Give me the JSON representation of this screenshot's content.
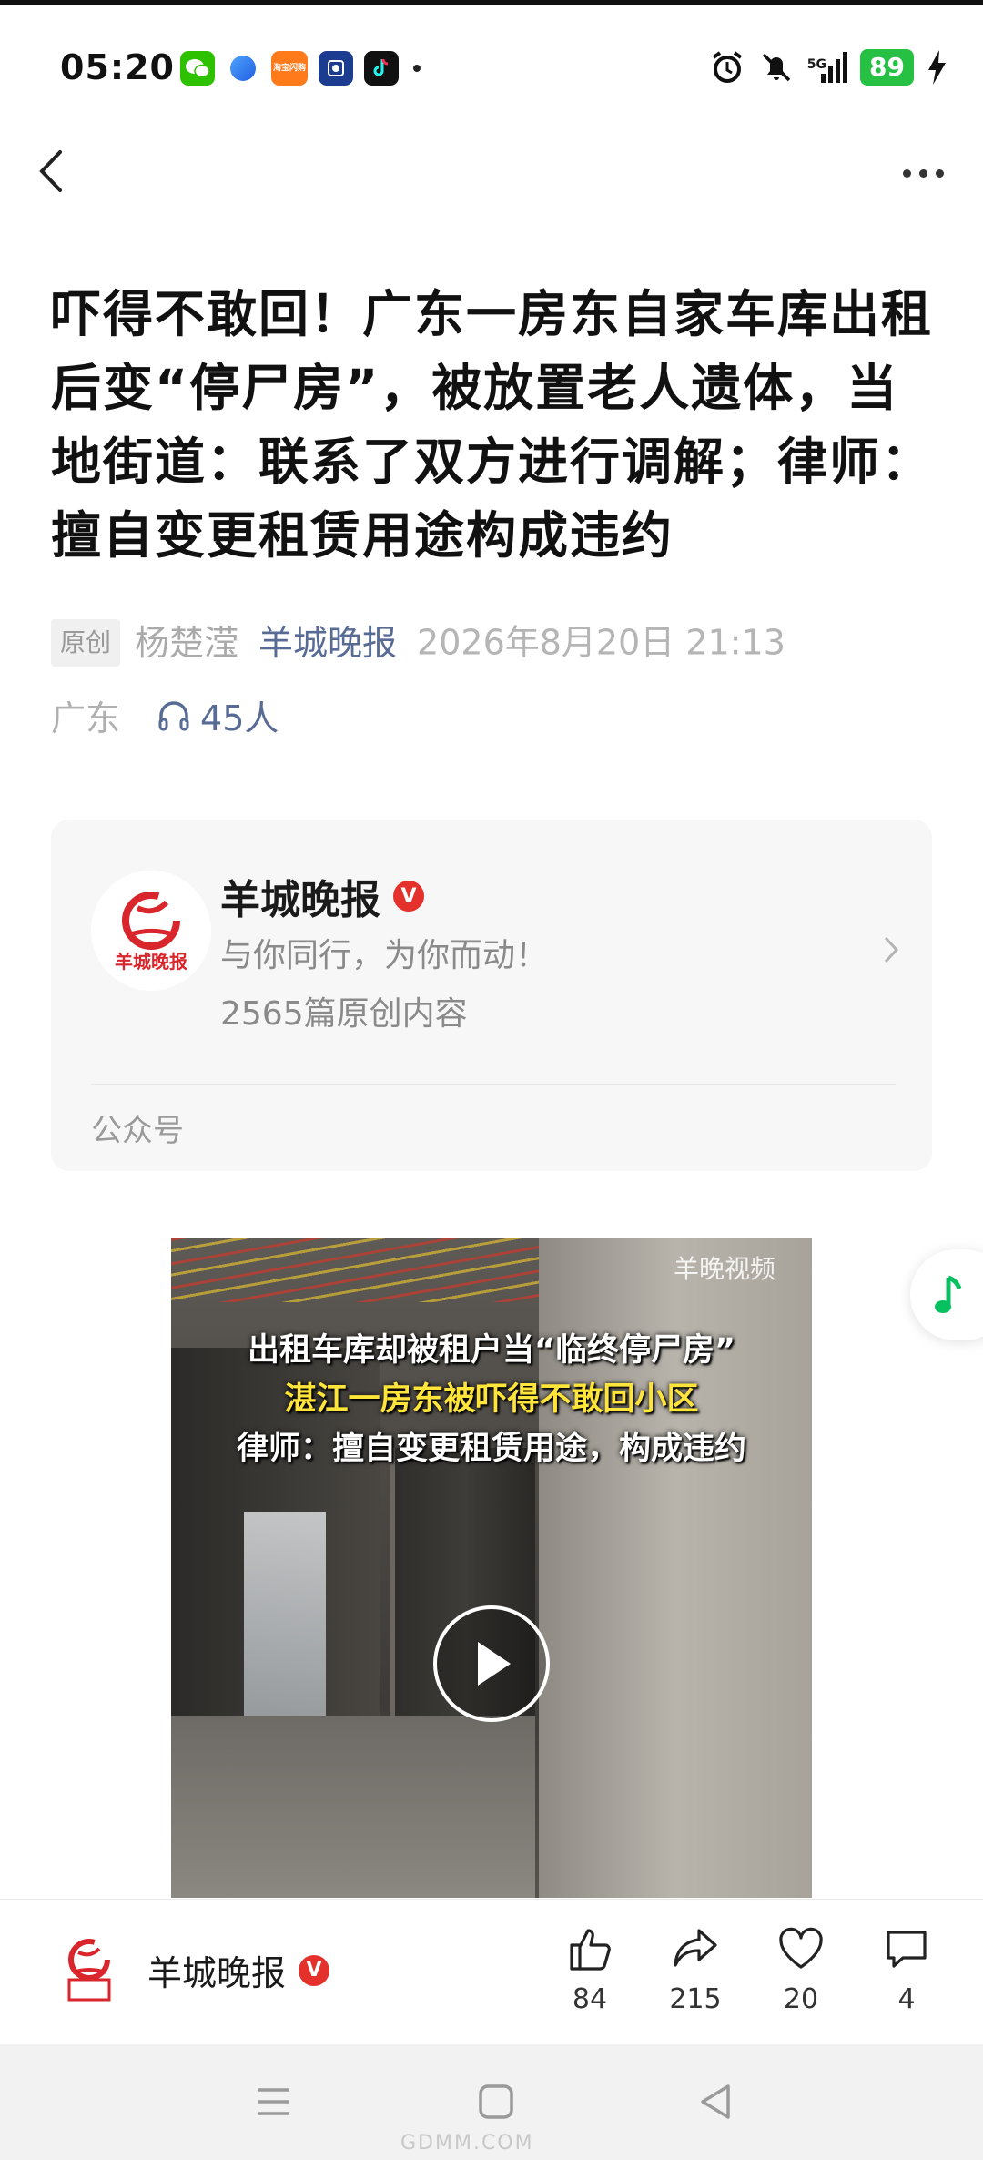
{
  "status_bar": {
    "time": "05:20",
    "network": "5G",
    "battery": "89",
    "app_icons": [
      "wechat-icon",
      "browser-icon",
      "taobao-flash-icon",
      "bank-icon",
      "tiktok-icon"
    ],
    "taobao_label": "淘宝闪购"
  },
  "article": {
    "title": "吓得不敢回！广东一房东自家车库出租后变“停尸房”，被放置老人遗体，当地街道：联系了双方进行调解；律师：擅自变更租赁用途构成违约",
    "badge": "原创",
    "author": "杨楚滢",
    "source": "羊城晚报",
    "date": "2026年8月20日 21:13",
    "location": "广东",
    "listeners": "45人"
  },
  "account_card": {
    "name": "羊城晚报",
    "verified_badge": "V",
    "slogan": "与你同行，为你而动！",
    "original_count": "2565篇原创内容",
    "type": "公众号",
    "logo_text": "羊城晚报"
  },
  "video": {
    "watermark": "羊晚视频",
    "caption_line1": "出租车库却被租户当“临终停尸房”",
    "caption_line2": "湛江一房东被吓得不敢回小区",
    "caption_line3": "律师：擅自变更租赁用途，构成违约"
  },
  "bottom_bar": {
    "account_name": "羊城晚报",
    "like_count": "84",
    "share_count": "215",
    "favorite_count": "20",
    "comment_count": "4"
  },
  "system_nav": {
    "watermark": "GDMM.COM"
  },
  "colors": {
    "link_blue": "#576b95",
    "verified_red": "#e4312b",
    "battery_green": "#26c043",
    "music_green": "#07c160"
  }
}
